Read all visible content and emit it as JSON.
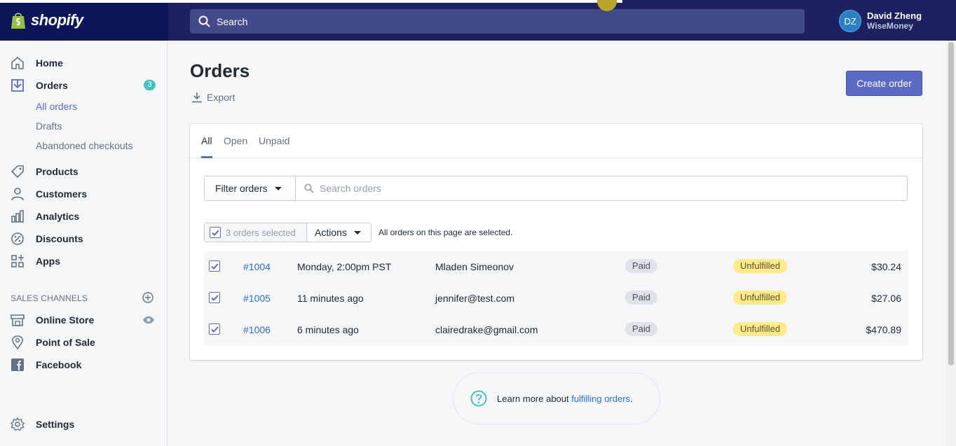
{
  "brand": {
    "name": "shopify"
  },
  "topbar": {
    "search_placeholder": "Search",
    "user_initials": "DZ",
    "user_name": "David Zheng",
    "user_org": "WiseMoney"
  },
  "sidebar": {
    "items": [
      {
        "label": "Home",
        "icon": "home-icon"
      },
      {
        "label": "Orders",
        "icon": "orders-icon",
        "badge": "3"
      },
      {
        "label": "Products",
        "icon": "tag-icon"
      },
      {
        "label": "Customers",
        "icon": "person-icon"
      },
      {
        "label": "Analytics",
        "icon": "bar-chart-icon"
      },
      {
        "label": "Discounts",
        "icon": "discount-icon"
      },
      {
        "label": "Apps",
        "icon": "apps-icon"
      }
    ],
    "orders_sub": [
      "All orders",
      "Drafts",
      "Abandoned checkouts"
    ],
    "sales_channels_title": "SALES CHANNELS",
    "channels": [
      {
        "label": "Online Store",
        "icon": "store-icon"
      },
      {
        "label": "Point of Sale",
        "icon": "location-pin-icon"
      },
      {
        "label": "Facebook",
        "icon": "facebook-icon"
      }
    ],
    "settings_label": "Settings"
  },
  "main": {
    "title": "Orders",
    "export_label": "Export",
    "create_label": "Create order",
    "tabs": [
      "All",
      "Open",
      "Unpaid"
    ],
    "filter_label": "Filter orders",
    "search_placeholder": "Search orders",
    "bulk": {
      "selected": "3 orders selected",
      "actions": "Actions",
      "note": "All orders on this page are selected."
    },
    "orders": [
      {
        "number": "#1004",
        "date": "Monday, 2:00pm PST",
        "customer": "Mladen Simeonov",
        "payment": "Paid",
        "fulfillment": "Unfulfilled",
        "total": "$30.24"
      },
      {
        "number": "#1005",
        "date": "11 minutes ago",
        "customer": "jennifer@test.com",
        "payment": "Paid",
        "fulfillment": "Unfulfilled",
        "total": "$27.06"
      },
      {
        "number": "#1006",
        "date": "6 minutes ago",
        "customer": "clairedrake@gmail.com",
        "payment": "Paid",
        "fulfillment": "Unfulfilled",
        "total": "$470.89"
      }
    ],
    "learn": {
      "prefix": "Learn more about ",
      "link": "fulfilling orders",
      "suffix": "."
    }
  },
  "colors": {
    "topbar": "#1c2260",
    "accent": "#5c6ac4",
    "link": "#2c6ecb",
    "unfulfilled": "#ffea8a",
    "badge": "#47c1bf"
  }
}
